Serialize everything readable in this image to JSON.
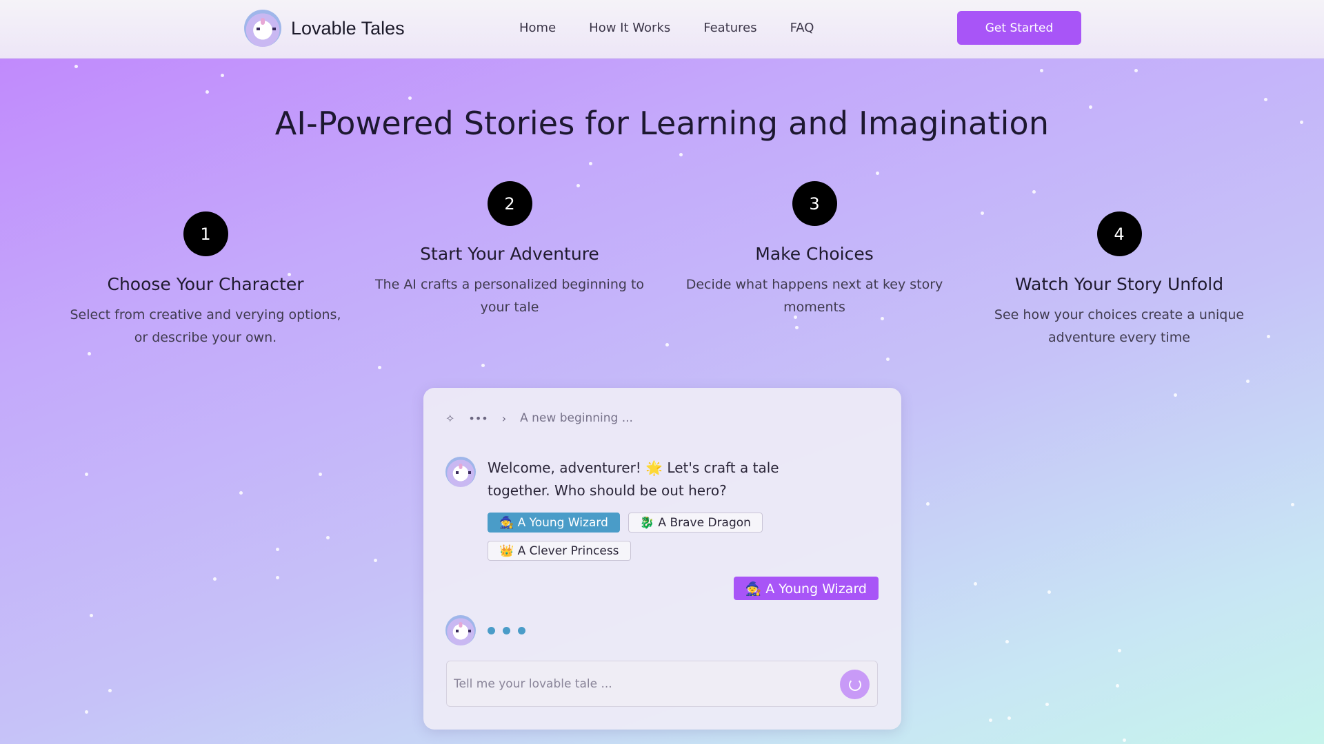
{
  "brand": {
    "name": "Lovable Tales",
    "logo_icon": "unicorn-logo-icon"
  },
  "nav": {
    "links": [
      "Home",
      "How It Works",
      "Features",
      "FAQ"
    ],
    "cta_label": "Get Started"
  },
  "hero": {
    "title": "AI-Powered Stories for Learning and Imagination"
  },
  "steps": [
    {
      "number": "1",
      "title": "Choose Your Character",
      "description": "Select from creative and verying options, or describe your own."
    },
    {
      "number": "2",
      "title": "Start Your Adventure",
      "description": "The AI crafts a personalized beginning to your tale"
    },
    {
      "number": "3",
      "title": "Make Choices",
      "description": "Decide what happens next at key story moments"
    },
    {
      "number": "4",
      "title": "Watch Your Story Unfold",
      "description": "See how your choices create a unique adventure every time"
    }
  ],
  "chat": {
    "breadcrumb": {
      "sparkle_icon": "sparkle-icon",
      "more_icon": "more-horizontal-icon",
      "chevron_icon": "chevron-right-icon",
      "current": "A new beginning ..."
    },
    "bot_message": "Welcome, adventurer! 🌟 Let's craft a tale together. Who should be out hero?",
    "choices": [
      {
        "label": "🧙 A Young Wizard",
        "selected": true
      },
      {
        "label": "🐉 A Brave Dragon",
        "selected": false
      },
      {
        "label": "👑 A Clever Princess",
        "selected": false
      }
    ],
    "user_reply": "🧙 A Young Wizard",
    "input_placeholder": "Tell me your lovable tale ...",
    "send_icon": "loading-spinner-icon"
  },
  "colors": {
    "accent": "#a855f7",
    "choice_selected": "#4a9cc8",
    "step_circle": "#000000"
  }
}
